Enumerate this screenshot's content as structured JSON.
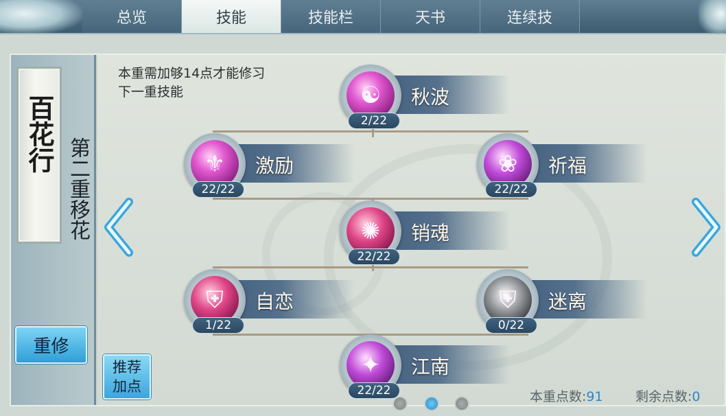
{
  "tabs": [
    {
      "label": "总览",
      "active": false
    },
    {
      "label": "技能",
      "active": true
    },
    {
      "label": "技能栏",
      "active": false
    },
    {
      "label": "天书",
      "active": false
    },
    {
      "label": "连续技",
      "active": false
    }
  ],
  "sect": {
    "plaque_text": "百花行",
    "tier_name": "第二重移花"
  },
  "buttons": {
    "reset_label": "重修",
    "recommend_line1": "推荐",
    "recommend_line2": "加点"
  },
  "hint_text": "本重需加够14点才能修习下一重技能",
  "skills": [
    {
      "name": "秋波",
      "count": "2/22",
      "icon": "swirl-icon"
    },
    {
      "name": "激励",
      "count": "22/22",
      "icon": "ornament-icon"
    },
    {
      "name": "祈福",
      "count": "22/22",
      "icon": "lotus-icon"
    },
    {
      "name": "销魂",
      "count": "22/22",
      "icon": "spiral-icon"
    },
    {
      "name": "自恋",
      "count": "1/22",
      "icon": "shield-icon"
    },
    {
      "name": "迷离",
      "count": "0/22",
      "icon": "gray-shield-icon"
    },
    {
      "name": "江南",
      "count": "22/22",
      "icon": "flourish-icon"
    }
  ],
  "points": {
    "tier_label": "本重点数:",
    "tier_value": "91",
    "remain_label": "剩余点数:",
    "remain_value": "0"
  },
  "pager": {
    "pages": 3,
    "current": 2
  }
}
